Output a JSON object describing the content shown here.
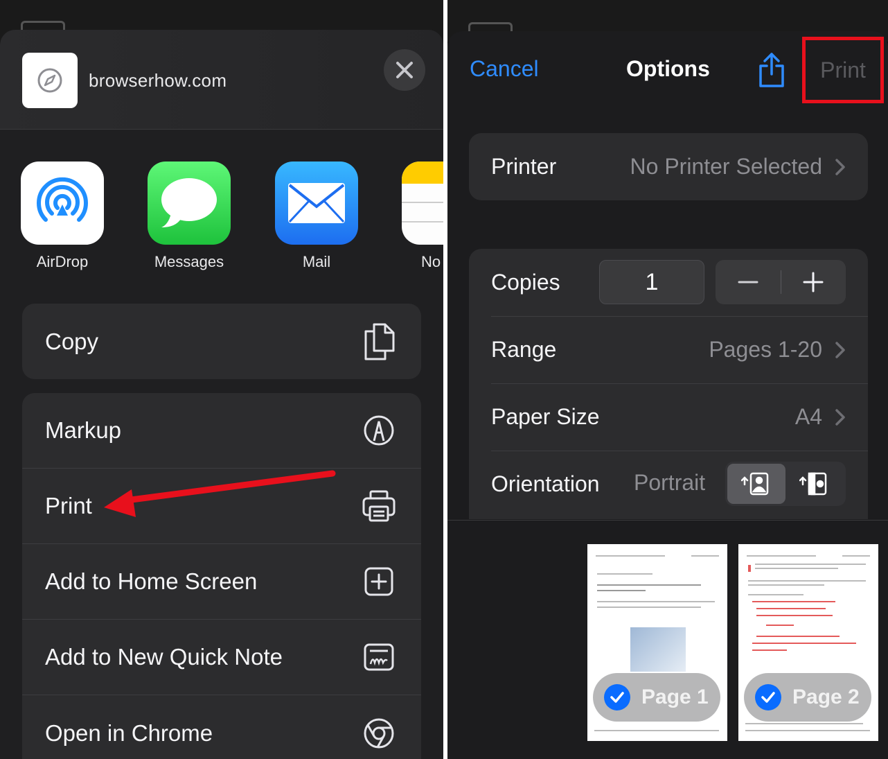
{
  "share_sheet": {
    "site_name": "browserhow.com",
    "apps": [
      {
        "label": "AirDrop",
        "icon": "airdrop-icon"
      },
      {
        "label": "Messages",
        "icon": "messages-icon"
      },
      {
        "label": "Mail",
        "icon": "mail-icon"
      },
      {
        "label": "No",
        "icon": "notes-icon"
      }
    ],
    "actions_top": [
      {
        "label": "Copy",
        "icon": "copy-icon"
      }
    ],
    "actions": [
      {
        "label": "Markup",
        "icon": "markup-icon"
      },
      {
        "label": "Print",
        "icon": "printer-icon"
      },
      {
        "label": "Add to Home Screen",
        "icon": "add-square-icon"
      },
      {
        "label": "Add to New Quick Note",
        "icon": "quick-note-icon"
      },
      {
        "label": "Open in Chrome",
        "icon": "chrome-icon"
      }
    ],
    "arrow_color": "#e8101c"
  },
  "print_options": {
    "nav": {
      "cancel": "Cancel",
      "title": "Options",
      "print": "Print",
      "accent": "#2f8cff",
      "highlight_color": "#e8101c"
    },
    "printer": {
      "label": "Printer",
      "value": "No Printer Selected"
    },
    "copies": {
      "label": "Copies",
      "value": "1"
    },
    "range": {
      "label": "Range",
      "value": "Pages 1-20"
    },
    "paper_size": {
      "label": "Paper Size",
      "value": "A4"
    },
    "orientation": {
      "label": "Orientation",
      "value": "Portrait"
    },
    "pages": [
      {
        "label": "Page 1",
        "selected": true
      },
      {
        "label": "Page 2",
        "selected": true
      }
    ]
  }
}
